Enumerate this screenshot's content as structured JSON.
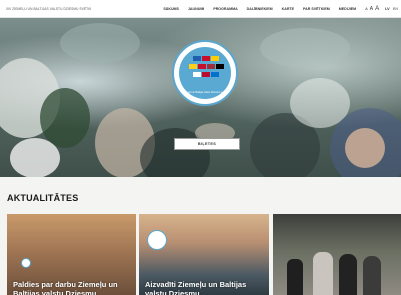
{
  "header": {
    "site_title": "XIII ZIEMEĻU UN BALTIJAS VALSTU DZIESMU SVĒTKI",
    "nav": [
      "SĀKUMS",
      "JAUNUMI",
      "PROGRAMMA",
      "DALĪBNIEKIEM",
      "KARTE",
      "PAR SVĒTKIEM",
      "MEDIJIEM"
    ],
    "font_small": "A",
    "font_medium": "A",
    "font_large": "A",
    "languages": [
      "LV",
      "EN"
    ]
  },
  "hero": {
    "logo_caption": "Ziemeļu un Baltijas valstu Dziesmu svētki",
    "button_label": "BIĻETES"
  },
  "news": {
    "heading": "AKTUALITĀTES",
    "cards": [
      {
        "caption": "Paldies par darbu Ziemeļu un Baltijas valstu Dziesmu"
      },
      {
        "caption": "Aizvadīti Ziemeļu un Baltijas valstu Dziesmu"
      },
      {
        "caption": ""
      }
    ]
  },
  "colors": {
    "accent": "#5aa9d3",
    "topbar": "#ffffff"
  }
}
